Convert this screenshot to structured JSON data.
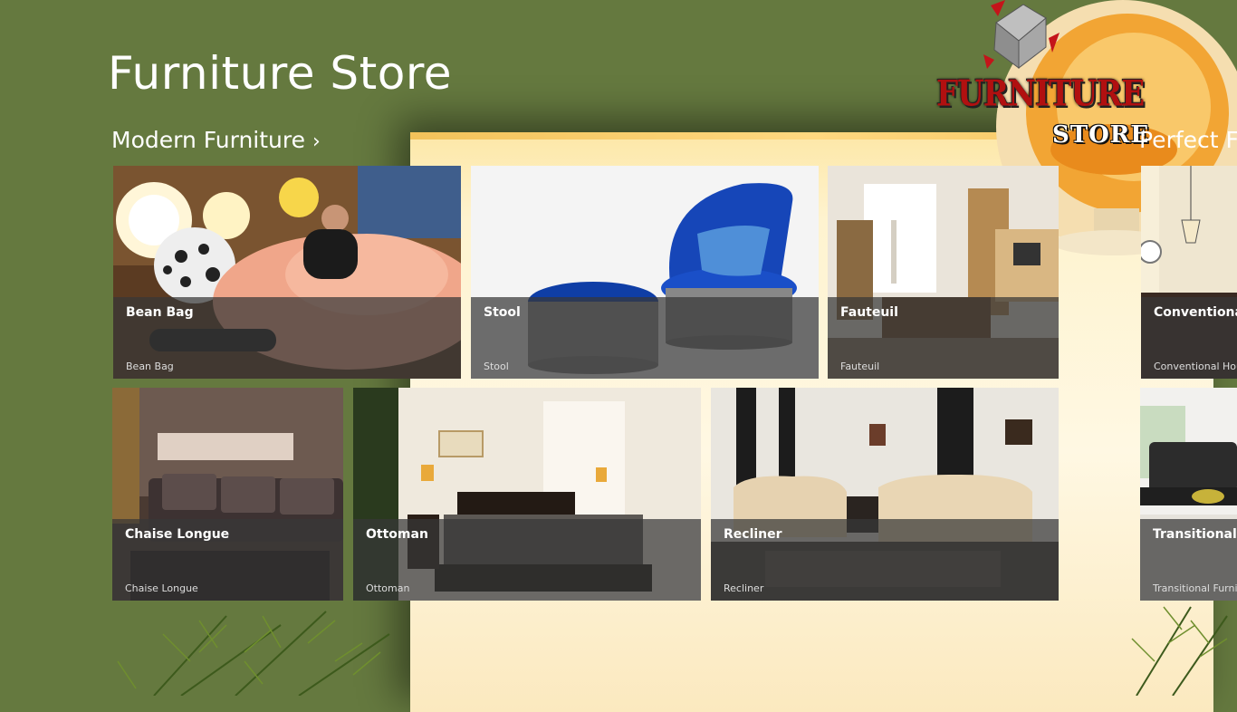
{
  "app": {
    "title": "Furniture Store"
  },
  "logo": {
    "line1": "FURNITURE",
    "line2": "STORE"
  },
  "groups": [
    {
      "header": "Modern Furniture",
      "tiles": [
        {
          "title": "Bean Bag",
          "subtitle": "Bean Bag"
        },
        {
          "title": "Stool",
          "subtitle": "Stool"
        },
        {
          "title": "Fauteuil",
          "subtitle": "Fauteuil"
        },
        {
          "title": "Chaise Longue",
          "subtitle": "Chaise Longue"
        },
        {
          "title": "Ottoman",
          "subtitle": "Ottoman"
        },
        {
          "title": "Recliner",
          "subtitle": "Recliner"
        }
      ]
    },
    {
      "header": "Perfect Fu",
      "tiles": [
        {
          "title": "Conventional",
          "subtitle": "Conventional Hou"
        },
        {
          "title": "Transitional Fu",
          "subtitle": "Transitional Furnit"
        }
      ]
    }
  ],
  "icons": {
    "group_chevron": "chevron-right-icon"
  },
  "colors": {
    "background": "#65793f",
    "panel": "#fff3cf",
    "tile_overlay": "#373737"
  }
}
